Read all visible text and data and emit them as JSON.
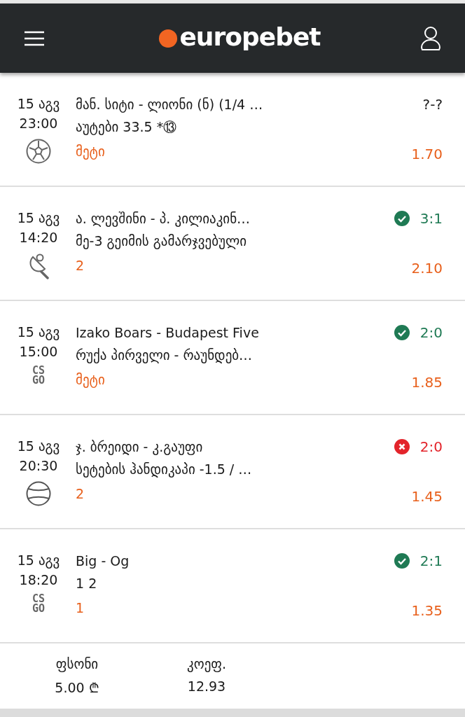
{
  "header": {
    "logo": "europebet"
  },
  "bets": [
    {
      "date": "15 აგვ",
      "time": "23:00",
      "sport": {
        "kind": "football"
      },
      "match": "მან. სიტი - ლიონი (ნ) (1/4 …",
      "market": "აუტები 33.5 *⑬",
      "pick": "მეტი",
      "kind": "pending",
      "score": "?-?",
      "odds": "1.70"
    },
    {
      "date": "15 აგვ",
      "time": "14:20",
      "sport": {
        "kind": "table-tennis"
      },
      "match": "ა. ლევშინი - პ. კილიაკინ…",
      "market": "მე-3 გეიმის გამარჯვებული",
      "pick": "2",
      "kind": "won",
      "score": "3:1",
      "odds": "2.10"
    },
    {
      "date": "15 აგვ",
      "time": "15:00",
      "sport": {
        "kind": "csgo",
        "label": [
          "CS",
          "GO"
        ]
      },
      "match": "Izako Boars - Budapest Five",
      "market": "რუქა პირველი - რაუნდებ…",
      "pick": "მეტი",
      "kind": "won",
      "score": "2:0",
      "odds": "1.85"
    },
    {
      "date": "15 აგვ",
      "time": "20:30",
      "sport": {
        "kind": "tennis"
      },
      "match": "ჯ. ბრეიდი - კ.გაუფი",
      "market": "სეტების ჰანდიკაპი -1.5 / …",
      "pick": "2",
      "kind": "lost",
      "score": "2:0",
      "odds": "1.45"
    },
    {
      "date": "15 აგვ",
      "time": "18:20",
      "sport": {
        "kind": "csgo",
        "label": [
          "CS",
          "GO"
        ]
      },
      "match": "Big - Og",
      "market": "1 2",
      "pick": "1",
      "kind": "won",
      "score": "2:1",
      "odds": "1.35"
    }
  ],
  "summary": [
    {
      "label": "ფსონი",
      "value": "5.00 ₾"
    },
    {
      "label": "კოეფ.",
      "value": "12.93"
    }
  ]
}
